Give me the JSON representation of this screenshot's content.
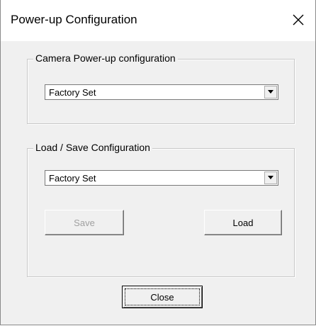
{
  "window": {
    "title": "Power-up Configuration",
    "close_icon": "close-icon"
  },
  "camera_group": {
    "legend": "Camera Power-up configuration",
    "select": {
      "value": "Factory Set",
      "icon": "dropdown-arrow-icon"
    }
  },
  "load_save_group": {
    "legend": "Load / Save Configuration",
    "select": {
      "value": "Factory Set",
      "icon": "dropdown-arrow-icon"
    },
    "save_button": {
      "label": "Save",
      "enabled": false
    },
    "load_button": {
      "label": "Load",
      "enabled": true
    }
  },
  "footer": {
    "close_button": {
      "label": "Close",
      "is_default": true
    }
  },
  "colors": {
    "dialog_bg": "#f0f0f0",
    "titlebar_bg": "#ffffff",
    "disabled_text": "#a0a0a0"
  }
}
